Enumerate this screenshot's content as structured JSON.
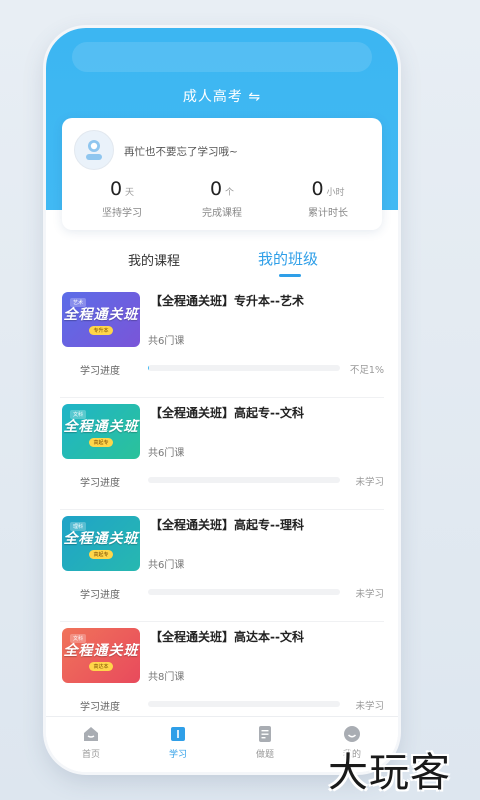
{
  "header": {
    "title": "成人高考 ⇋"
  },
  "stats_card": {
    "greeting": "再忙也不要忘了学习哦~",
    "stats": [
      {
        "value": "0",
        "unit": "天",
        "label": "坚持学习"
      },
      {
        "value": "0",
        "unit": "个",
        "label": "完成课程"
      },
      {
        "value": "0",
        "unit": "小时",
        "label": "累计时长"
      }
    ]
  },
  "tabs": [
    {
      "label": "我的课程",
      "active": false
    },
    {
      "label": "我的班级",
      "active": true
    }
  ],
  "courses": [
    {
      "thumb_tag": "艺术",
      "thumb_title": "全程通关班",
      "thumb_pill": "专升本",
      "thumb_colors": [
        "#5b6de8",
        "#7a55d8"
      ],
      "title": "【全程通关班】专升本--艺术",
      "count": "共6门课",
      "progress_label": "学习进度",
      "progress": 0.005,
      "status": "不足1%"
    },
    {
      "thumb_tag": "文科",
      "thumb_title": "全程通关班",
      "thumb_pill": "高起专",
      "thumb_colors": [
        "#1fb4c8",
        "#2bc29a"
      ],
      "title": "【全程通关班】高起专--文科",
      "count": "共6门课",
      "progress_label": "学习进度",
      "progress": 0,
      "status": "未学习"
    },
    {
      "thumb_tag": "理科",
      "thumb_title": "全程通关班",
      "thumb_pill": "高起专",
      "thumb_colors": [
        "#1fa3c8",
        "#27b8b0"
      ],
      "title": "【全程通关班】高起专--理科",
      "count": "共6门课",
      "progress_label": "学习进度",
      "progress": 0,
      "status": "未学习"
    },
    {
      "thumb_tag": "文科",
      "thumb_title": "全程通关班",
      "thumb_pill": "高达本",
      "thumb_colors": [
        "#f0735a",
        "#e84a5c"
      ],
      "title": "【全程通关班】高达本--文科",
      "count": "共8门课",
      "progress_label": "学习进度",
      "progress": 0,
      "status": "未学习"
    }
  ],
  "bottom_nav": [
    {
      "label": "首页",
      "icon": "home-icon",
      "active": false
    },
    {
      "label": "学习",
      "icon": "book-icon",
      "active": true
    },
    {
      "label": "做题",
      "icon": "edit-icon",
      "active": false
    },
    {
      "label": "我的",
      "icon": "smile-icon",
      "active": false
    }
  ],
  "watermark": "大玩客",
  "colors": {
    "brand": "#41b9f3",
    "accent": "#2f9fe8"
  }
}
